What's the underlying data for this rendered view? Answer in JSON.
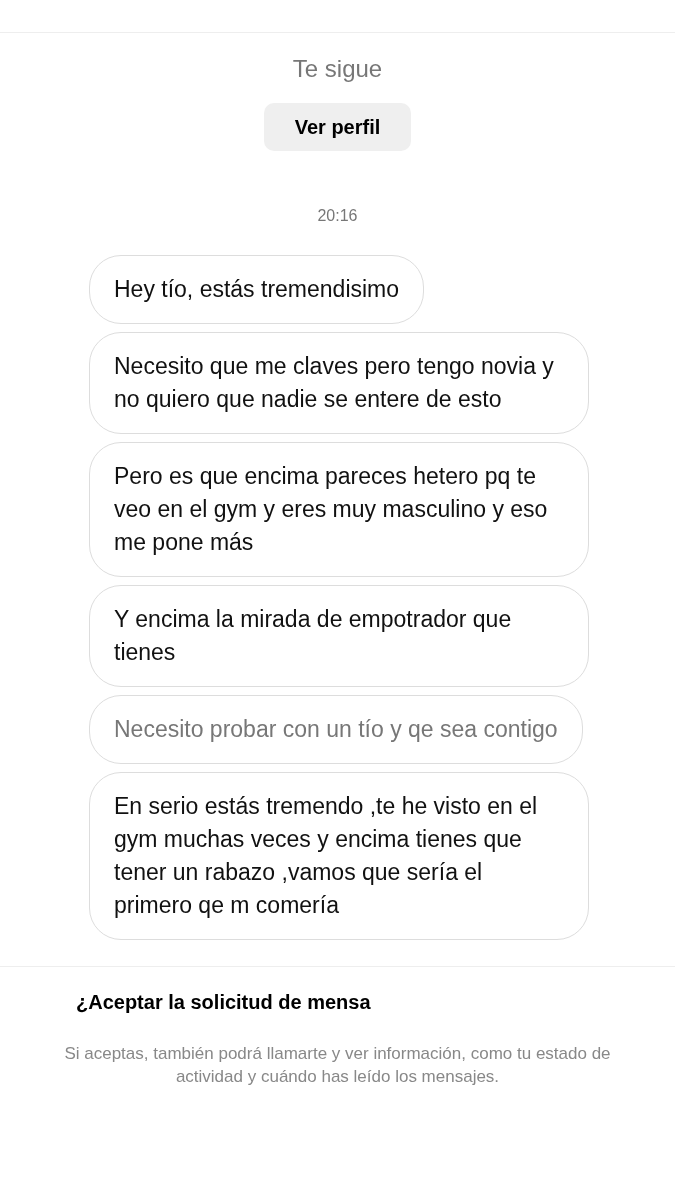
{
  "header": {
    "follow_status": "Te sigue",
    "profile_button": "Ver perfil"
  },
  "timestamp": "20:16",
  "messages": [
    {
      "text": "Hey tío, estás tremendisimo",
      "dimmed": false
    },
    {
      "text": "Necesito que me claves pero tengo novia y no quiero que nadie se entere de esto",
      "dimmed": false
    },
    {
      "text": "Pero es que encima pareces hetero pq te veo en el gym y eres muy masculino y eso me pone más",
      "dimmed": false
    },
    {
      "text": "Y encima la mirada de empotrador que tienes",
      "dimmed": false
    },
    {
      "text": "Necesito probar con un tío y qe sea contigo",
      "dimmed": true
    },
    {
      "text": "En serio estás tremendo ,te he visto en el gym muchas veces y encima tienes que tener un rabazo ,vamos que sería el primero qe m comería",
      "dimmed": false
    }
  ],
  "request": {
    "title": "¿Aceptar la solicitud de mensa",
    "description": "Si aceptas, también podrá llamarte y ver información, como tu estado de actividad y cuándo has leído los mensajes."
  }
}
